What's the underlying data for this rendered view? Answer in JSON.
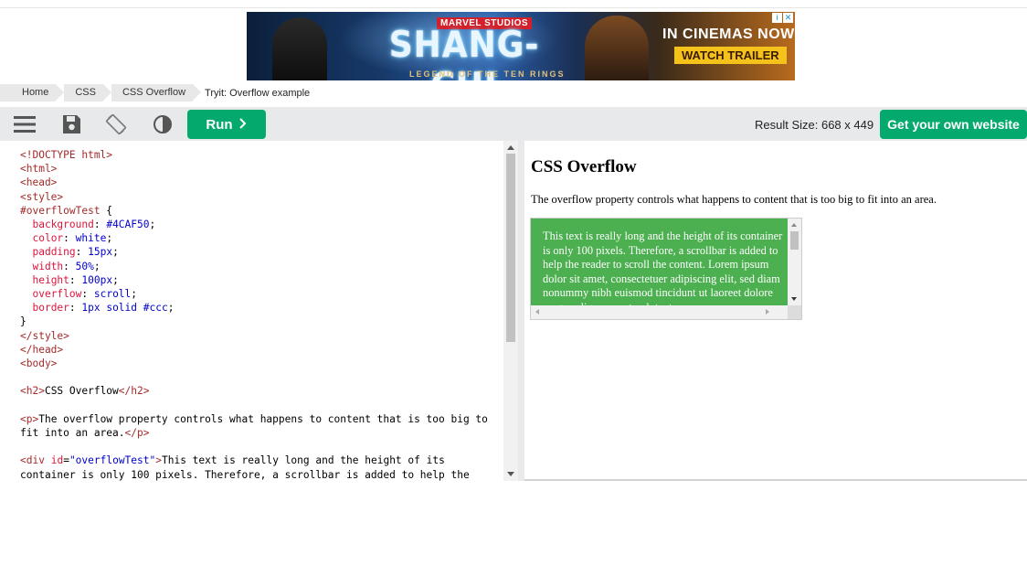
{
  "ad": {
    "studio": "MARVEL STUDIOS",
    "title": "SHANG-CHI",
    "subtitle": "LEGEND OF THE TEN RINGS",
    "tagline": "IN CINEMAS NOW",
    "cta": "WATCH TRAILER",
    "icons": [
      "info-icon",
      "close-icon"
    ]
  },
  "breadcrumb": {
    "items": [
      "Home",
      "CSS",
      "CSS Overflow"
    ],
    "current": "Tryit: Overflow example"
  },
  "toolbar": {
    "icons": [
      "menu-icon",
      "save-icon",
      "rotate-icon",
      "contrast-icon"
    ],
    "run_label": "Run",
    "run_icon": "chevron-right-icon",
    "result_size": "Result Size: 668 x 449",
    "own_site_label": "Get your own website"
  },
  "editor": {
    "lines": {
      "l1": "<!DOCTYPE html>",
      "l2": "<html>",
      "l3": "<head>",
      "l4": "<style>",
      "l5_sel": "#overflowTest",
      "l5_brace": " {",
      "l6_prop": "background",
      "l6_val": "#4CAF50",
      "l7_prop": "color",
      "l7_val": "white",
      "l8_prop": "padding",
      "l8_val": "15px",
      "l9_prop": "width",
      "l9_val": "50%",
      "l10_prop": "height",
      "l10_val": "100px",
      "l11_prop": "overflow",
      "l11_val": "scroll",
      "l12_prop": "border",
      "l12_val": "1px solid #ccc",
      "l13": "}",
      "l14": "</style>",
      "l15": "</head>",
      "l16": "<body>",
      "l17_open": "<h2>",
      "l17_text": "CSS Overflow",
      "l17_close": "</h2>",
      "l18_open": "<p>",
      "l18_text": "The overflow property controls what happens to content that is too big to fit into an area.",
      "l18_close": "</p>",
      "l19_open": "<div",
      "l19_attr": "id",
      "l19_val": "\"overflowTest\"",
      "l19_text": "This text is really long and the height of its container is only 100 pixels. Therefore, a scrollbar is added to help the reader to scroll the content. Lorem ipsum dolor sit amet, consectetuer"
    }
  },
  "result": {
    "heading": "CSS Overflow",
    "paragraph": "The overflow property controls what happens to content that is too big to fit into an area.",
    "box_text": "This text is really long and the height of its container is only 100 pixels. Therefore, a scrollbar is added to help the reader to scroll the content. Lorem ipsum dolor sit amet, consectetuer adipiscing elit, sed diam nonummy nibh euismod tincidunt ut laoreet dolore magna aliquam erat volutpat.",
    "box_color": "#4CAF50"
  },
  "colors": {
    "accent": "#04AA6D",
    "toolbar_bg": "#E7E9EB"
  }
}
